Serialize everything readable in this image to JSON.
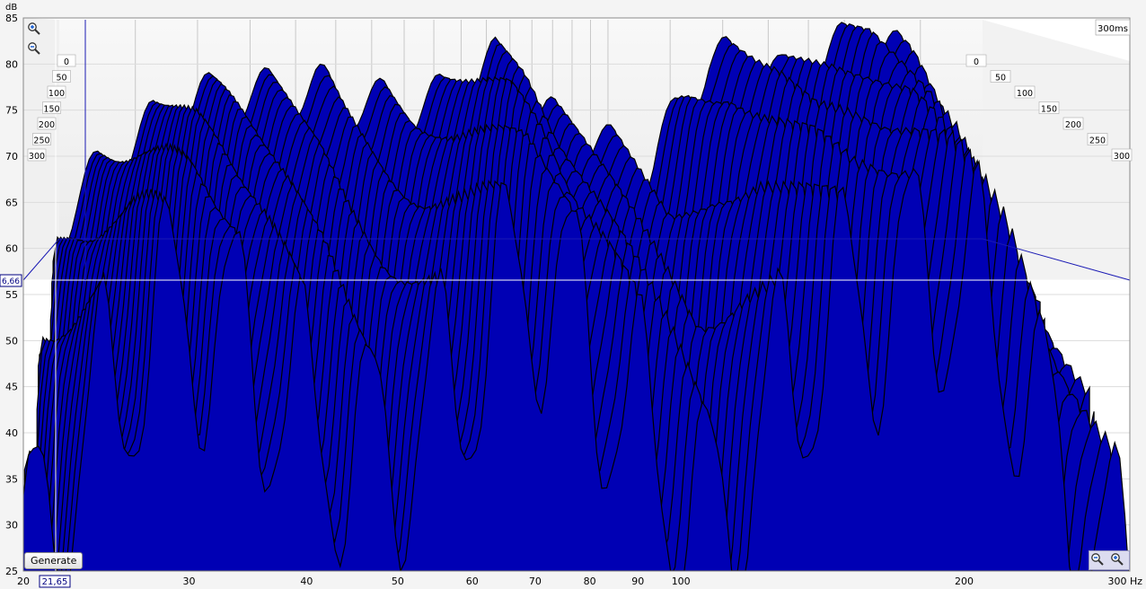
{
  "generate_label": "Generate",
  "cursor": {
    "freq_readout": "21,65",
    "db_readout": "6,66"
  },
  "chart_data": {
    "type": "waterfall",
    "y_unit": "dB",
    "x_unit": "Hz",
    "x_scale": "log",
    "x_range": [
      20,
      300
    ],
    "y_range": [
      25,
      85
    ],
    "time_range_ms": [
      0,
      300
    ],
    "x_ticks": [
      {
        "v": 20,
        "label": "20"
      },
      {
        "v": 30,
        "label": "30"
      },
      {
        "v": 40,
        "label": "40"
      },
      {
        "v": 50,
        "label": "50"
      },
      {
        "v": 60,
        "label": "60"
      },
      {
        "v": 70,
        "label": "70"
      },
      {
        "v": 80,
        "label": "80"
      },
      {
        "v": 90,
        "label": "90"
      },
      {
        "v": 100,
        "label": "100"
      },
      {
        "v": 200,
        "label": "200"
      },
      {
        "v": 300,
        "label": "300 Hz"
      }
    ],
    "y_ticks": [
      "25",
      "30",
      "35",
      "40",
      "45",
      "50",
      "55",
      "60",
      "65",
      "70",
      "75",
      "80",
      "85"
    ],
    "time_ticks": [
      "0",
      "50",
      "100",
      "150",
      "200",
      "250",
      "300"
    ],
    "back_time_label": "300ms",
    "slice_count": 30,
    "front_slice_peaks_db": [
      {
        "f": 20,
        "db": 62
      },
      {
        "f": 21.65,
        "db": 66.7
      },
      {
        "f": 23,
        "db": 69
      },
      {
        "f": 26,
        "db": 73
      },
      {
        "f": 30,
        "db": 76
      },
      {
        "f": 35,
        "db": 76.5
      },
      {
        "f": 40,
        "db": 77
      },
      {
        "f": 42,
        "db": 77.3
      },
      {
        "f": 45,
        "db": 76
      },
      {
        "f": 50,
        "db": 75.5
      },
      {
        "f": 55,
        "db": 75
      },
      {
        "f": 60,
        "db": 76
      },
      {
        "f": 65,
        "db": 78
      },
      {
        "f": 70,
        "db": 80
      },
      {
        "f": 75,
        "db": 78
      },
      {
        "f": 80,
        "db": 74
      },
      {
        "f": 90,
        "db": 72
      },
      {
        "f": 100,
        "db": 70
      },
      {
        "f": 110,
        "db": 68
      },
      {
        "f": 120,
        "db": 76
      },
      {
        "f": 130,
        "db": 80
      },
      {
        "f": 140,
        "db": 80
      },
      {
        "f": 150,
        "db": 80
      },
      {
        "f": 160,
        "db": 78
      },
      {
        "f": 180,
        "db": 80
      },
      {
        "f": 200,
        "db": 83
      },
      {
        "f": 230,
        "db": 80
      },
      {
        "f": 260,
        "db": 70
      },
      {
        "f": 300,
        "db": 60
      }
    ],
    "colors": {
      "fill": "#0000b4",
      "slice_line": "#000000",
      "grid": "#c8c8c8",
      "cursor": "#ffffff",
      "cursor_box": "#000080"
    },
    "grid": true,
    "legend": "none"
  }
}
